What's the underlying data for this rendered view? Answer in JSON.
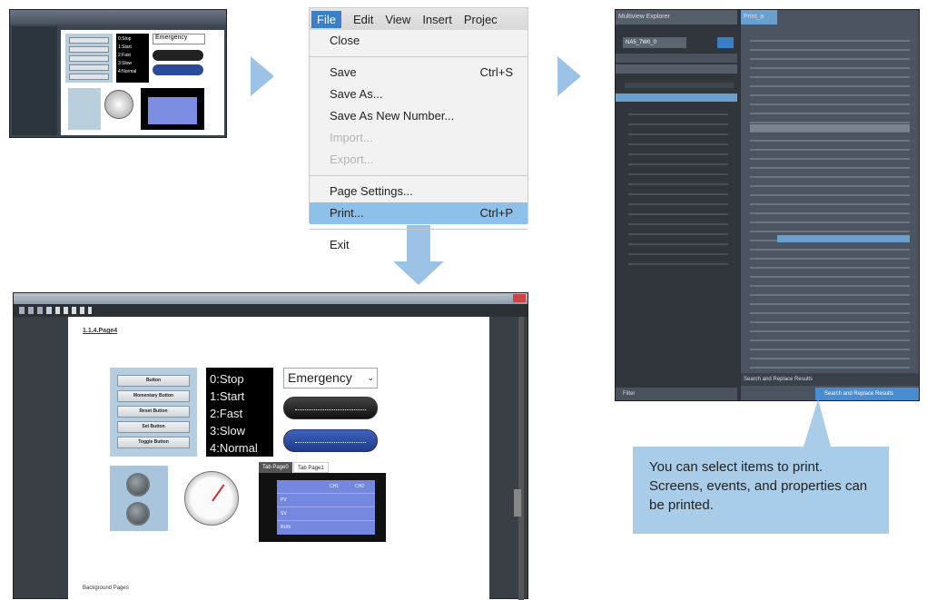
{
  "menu": {
    "bar": [
      "File",
      "Edit",
      "View",
      "Insert",
      "Projec"
    ],
    "items": [
      {
        "label": "Close",
        "shortcut": "",
        "state": "normal"
      },
      {
        "label": "Save",
        "shortcut": "Ctrl+S",
        "state": "normal"
      },
      {
        "label": "Save As...",
        "shortcut": "",
        "state": "normal"
      },
      {
        "label": "Save As New Number...",
        "shortcut": "",
        "state": "normal"
      },
      {
        "label": "Import...",
        "shortcut": "",
        "state": "disabled"
      },
      {
        "label": "Export...",
        "shortcut": "",
        "state": "disabled"
      },
      {
        "label": "Page Settings...",
        "shortcut": "",
        "state": "normal"
      },
      {
        "label": "Print...",
        "shortcut": "Ctrl+P",
        "state": "selected"
      },
      {
        "label": "Exit",
        "shortcut": "",
        "state": "normal"
      }
    ]
  },
  "thumb1": {
    "panel_lines": [
      "0:Stop",
      "1:Start",
      "2:Fast",
      "3:Slow",
      "4:Normal"
    ],
    "emergency": "Emergency"
  },
  "project_tree": {
    "left_header": "Multiview Explorer",
    "right_header": "Print_a",
    "device": "NA5_7W0_0",
    "footer": "Filter",
    "search_header": "Search and Replace Results",
    "search_tab": "Search and Replace Results"
  },
  "callout": {
    "text": "You can select items to print. Screens, events, and properties can be printed."
  },
  "preview": {
    "page_label": "1.1.4.Page4",
    "buttons": [
      "Button",
      "Momentary Button",
      "Reset Button",
      "Set Button",
      "Toggle Button"
    ],
    "lines": [
      "0:Stop",
      "1:Start",
      "2:Fast",
      "3:Slow",
      "4:Normal"
    ],
    "emergency": "Emergency",
    "tabs": [
      "Tab Page0",
      "Tab Page1"
    ],
    "grid_headers": [
      "CH1",
      "CH2"
    ],
    "grid_rows": [
      "PV",
      "SV",
      "RUN"
    ],
    "footer": "Background Pages"
  }
}
